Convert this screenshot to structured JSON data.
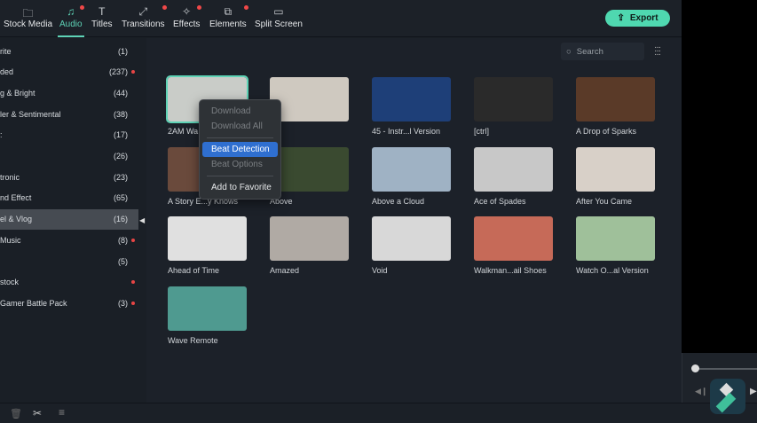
{
  "tabs": [
    {
      "label": "Stock Media",
      "icon": "folder-icon"
    },
    {
      "label": "Audio",
      "icon": "music-icon",
      "dot": true,
      "active": true
    },
    {
      "label": "Titles",
      "icon": "text-icon"
    },
    {
      "label": "Transitions",
      "icon": "transition-icon",
      "dot": true
    },
    {
      "label": "Effects",
      "icon": "effects-icon",
      "dot": true
    },
    {
      "label": "Elements",
      "icon": "elements-icon",
      "dot": true
    },
    {
      "label": "Split Screen",
      "icon": "split-screen-icon"
    }
  ],
  "export_label": "Export",
  "search_placeholder": "Search",
  "sidebar": [
    {
      "label": "rite",
      "count": "(1)"
    },
    {
      "label": "ded",
      "count": "(237)",
      "dot": true
    },
    {
      "label": "g & Bright",
      "count": "(44)"
    },
    {
      "label": "ler & Sentimental",
      "count": "(38)"
    },
    {
      "label": ":",
      "count": "(17)"
    },
    {
      "label": "",
      "count": "(26)"
    },
    {
      "label": "tronic",
      "count": "(23)"
    },
    {
      "label": "nd Effect",
      "count": "(65)"
    },
    {
      "label": "el & Vlog",
      "count": "(16)",
      "selected": true
    },
    {
      "label": " Music",
      "count": "(8)",
      "dot": true
    },
    {
      "label": "",
      "count": "(5)"
    },
    {
      "label": "stock",
      "count": "",
      "dot": true
    },
    {
      "label": " Gamer Battle Pack",
      "count": "(3)",
      "dot": true
    }
  ],
  "items": [
    {
      "title": "2AM Wa",
      "color": "#c9ccc8"
    },
    {
      "title": "",
      "color": "#cfc9c0"
    },
    {
      "title": "45 - Instr...l Version",
      "color": "#1e3f78"
    },
    {
      "title": "[ctrl]",
      "color": "#2a2a2a"
    },
    {
      "title": "A Drop of Sparks",
      "color": "#5a3a28"
    },
    {
      "title": "A Story E...y Knows",
      "color": "#6a4a3c"
    },
    {
      "title": "Above",
      "color": "#3a4a30"
    },
    {
      "title": "Above a Cloud",
      "color": "#9fb2c4"
    },
    {
      "title": "Ace of Spades",
      "color": "#c8c8c8"
    },
    {
      "title": "After You Came",
      "color": "#d8d0c8"
    },
    {
      "title": "Ahead of Time",
      "color": "#e0e0e0"
    },
    {
      "title": "Amazed",
      "color": "#b0aaa4"
    },
    {
      "title": "Void",
      "color": "#d8d8d8"
    },
    {
      "title": "Walkman...ail Shoes",
      "color": "#c66a58"
    },
    {
      "title": "Watch O...al Version",
      "color": "#9fc09a"
    },
    {
      "title": "Wave Remote",
      "color": "#4f9a90"
    }
  ],
  "context_menu": [
    {
      "label": "Download",
      "disabled": true
    },
    {
      "label": "Download All",
      "disabled": true
    },
    {
      "sep": true
    },
    {
      "label": "Beat Detection",
      "highlighted": true
    },
    {
      "label": "Beat Options",
      "disabled": true
    },
    {
      "sep": true
    },
    {
      "label": "Add to Favorite"
    }
  ],
  "accent": "#5ed3b6"
}
